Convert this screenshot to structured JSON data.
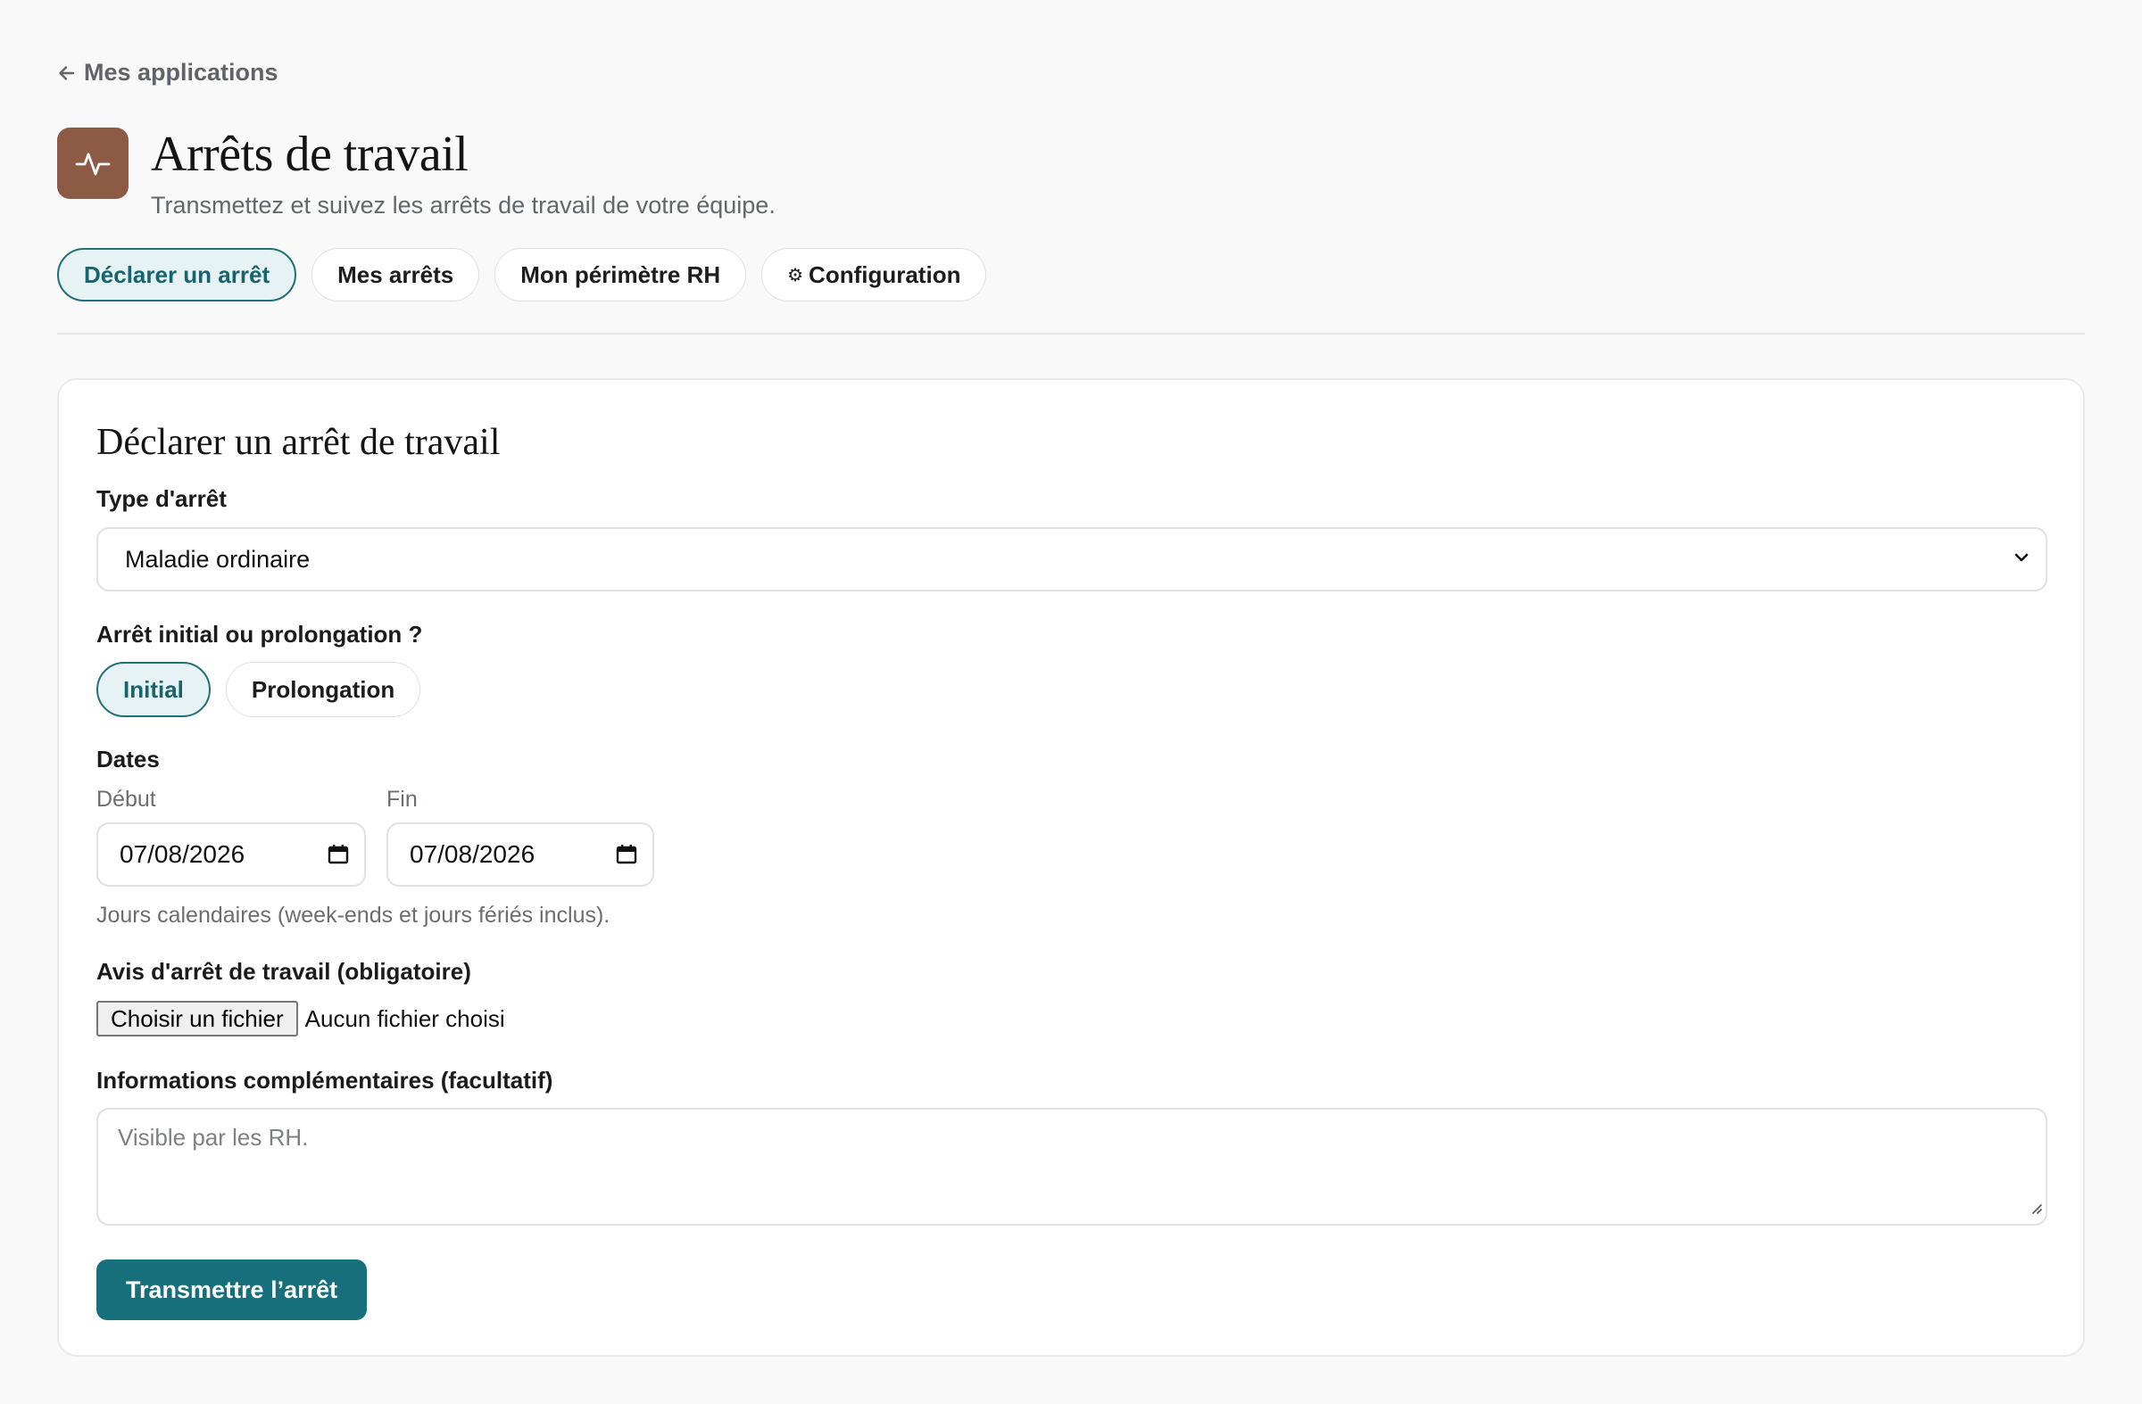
{
  "nav": {
    "back_label": "Mes applications"
  },
  "app": {
    "title": "Arrêts de travail",
    "subtitle": "Transmettez et suivez les arrêts de travail de votre équipe.",
    "icon": "activity-pulse-icon",
    "icon_color": "#8d5a45"
  },
  "tabs": [
    {
      "label": "Déclarer un arrêt",
      "active": true
    },
    {
      "label": "Mes arrêts",
      "active": false
    },
    {
      "label": "Mon périmètre RH",
      "active": false
    },
    {
      "label": "Configuration",
      "icon": "gear-icon",
      "icon_glyph": "⚙",
      "active": false
    }
  ],
  "form": {
    "title": "Déclarer un arrêt de travail",
    "type": {
      "label": "Type d'arrêt",
      "value": "Maladie ordinaire"
    },
    "kind": {
      "label": "Arrêt initial ou prolongation ?",
      "options": [
        {
          "label": "Initial",
          "selected": true
        },
        {
          "label": "Prolongation",
          "selected": false
        }
      ]
    },
    "dates": {
      "label": "Dates",
      "start_label": "Début",
      "start_value": "07/08/2026",
      "end_label": "Fin",
      "end_value": "07/08/2026",
      "hint": "Jours calendaires (week-ends et jours fériés inclus)."
    },
    "attachment": {
      "label": "Avis d'arrêt de travail (obligatoire)",
      "button_label": "Choisir un fichier",
      "status": "Aucun fichier choisi"
    },
    "notes": {
      "label": "Informations complémentaires (facultatif)",
      "placeholder": "Visible par les RH.",
      "value": ""
    },
    "submit_label": "Transmettre l’arrêt"
  },
  "colors": {
    "accent": "#176f7b",
    "accent_light_bg": "#e6f2f3",
    "page_bg": "#f9f9f9",
    "app_icon_bg": "#8d5a45"
  }
}
